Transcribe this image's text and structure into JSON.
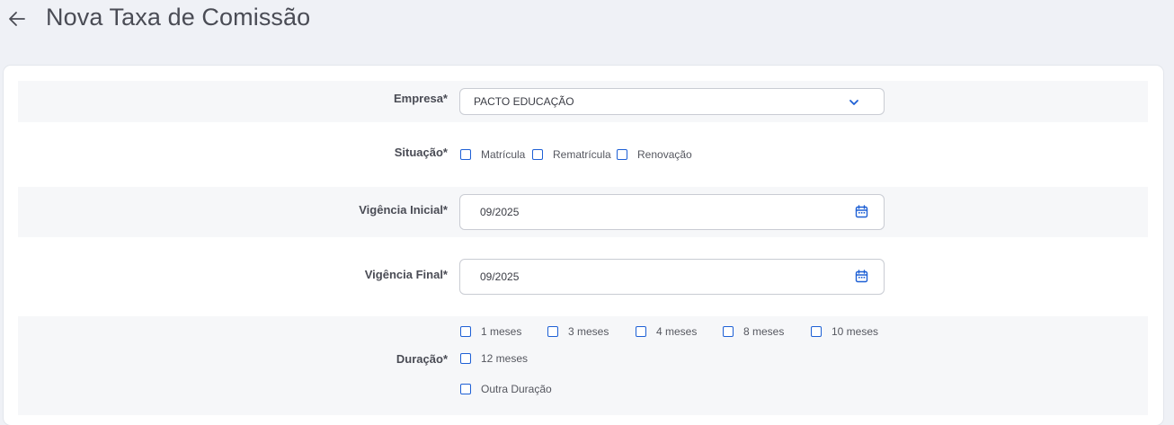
{
  "header": {
    "title": "Nova Taxa de Comissão",
    "back_icon": "arrow-left-icon"
  },
  "form": {
    "empresa": {
      "label": "Empresa*",
      "value": "PACTO EDUCAÇÃO",
      "icon": "chevron-down-icon"
    },
    "situacao": {
      "label": "Situação*",
      "options": [
        "Matrícula",
        "Rematrícula",
        "Renovação"
      ]
    },
    "vigencia_inicial": {
      "label": "Vigência Inicial*",
      "value": "09/2025",
      "icon": "calendar-icon"
    },
    "vigencia_final": {
      "label": "Vigência Final*",
      "value": "09/2025",
      "icon": "calendar-icon"
    },
    "duracao": {
      "label": "Duração*",
      "options": [
        "1 meses",
        "3 meses",
        "4 meses",
        "8 meses",
        "10 meses",
        "12 meses",
        "Outra Duração"
      ]
    }
  },
  "colors": {
    "accent": "#1e60d5",
    "background": "#eff1f6",
    "row_shade": "#f6f7f9",
    "title_text": "#4a4c55"
  }
}
